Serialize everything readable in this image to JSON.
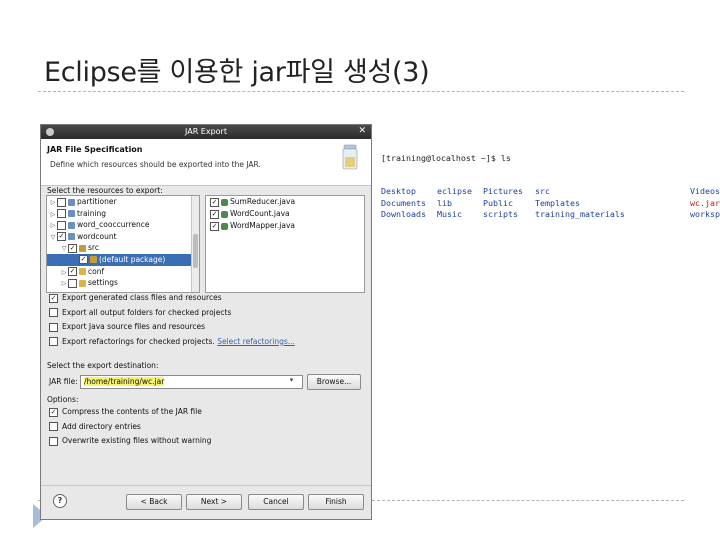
{
  "slide": {
    "title": "Eclipse를 이용한 jar파일 생성(3)"
  },
  "dialog": {
    "window_title": "JAR Export",
    "header_title": "JAR File Specification",
    "header_desc": "Define which resources should be exported into the JAR.",
    "resources_label": "Select the resources to export:",
    "tree": [
      {
        "indent": 0,
        "twisty": "▷",
        "checked": false,
        "icon": "project",
        "label": "partitioner",
        "selected": false
      },
      {
        "indent": 0,
        "twisty": "▷",
        "checked": false,
        "icon": "project",
        "label": "training",
        "selected": false
      },
      {
        "indent": 0,
        "twisty": "▷",
        "checked": false,
        "icon": "project",
        "label": "word_cooccurrence",
        "selected": false
      },
      {
        "indent": 0,
        "twisty": "▽",
        "checked": true,
        "icon": "project",
        "label": "wordcount",
        "selected": false
      },
      {
        "indent": 1,
        "twisty": "▽",
        "checked": true,
        "icon": "package",
        "label": "src",
        "selected": false
      },
      {
        "indent": 2,
        "twisty": "",
        "checked": true,
        "icon": "package",
        "label": "(default package)",
        "selected": true
      },
      {
        "indent": 1,
        "twisty": "▷",
        "checked": true,
        "icon": "folder",
        "label": "conf",
        "selected": false
      },
      {
        "indent": 1,
        "twisty": "▷",
        "checked": false,
        "icon": "folder",
        "label": "settings",
        "selected": false
      }
    ],
    "files": [
      {
        "checked": true,
        "label": "SumReducer.java"
      },
      {
        "checked": true,
        "label": "WordCount.java"
      },
      {
        "checked": true,
        "label": "WordMapper.java"
      }
    ],
    "export_options": [
      {
        "checked": true,
        "label": "Export generated class files and resources",
        "link": ""
      },
      {
        "checked": false,
        "label": "Export all output folders for checked projects",
        "link": ""
      },
      {
        "checked": false,
        "label": "Export Java source files and resources",
        "link": ""
      },
      {
        "checked": false,
        "label": "Export refactorings for checked projects.",
        "link": "Select refactorings..."
      }
    ],
    "destination_label": "Select the export destination:",
    "jar_file_label": "JAR file:",
    "jar_file_value": "/home/training/wc.jar",
    "browse_label": "Browse...",
    "options_label": "Options:",
    "options": [
      {
        "checked": true,
        "label": "Compress the contents of the JAR file"
      },
      {
        "checked": false,
        "label": "Add directory entries"
      },
      {
        "checked": false,
        "label": "Overwrite existing files without warning"
      }
    ],
    "buttons": {
      "back": "< Back",
      "next": "Next >",
      "cancel": "Cancel",
      "finish": "Finish"
    },
    "help_glyph": "?"
  },
  "terminal": {
    "prompt": "[training@localhost ~]$ ls",
    "rows": [
      [
        "Desktop",
        "eclipse",
        "Pictures",
        "src",
        "",
        "Videos"
      ],
      [
        "Documents",
        "lib",
        "Public",
        "Templates",
        "",
        "wc.jar"
      ],
      [
        "Downloads",
        "Music",
        "scripts",
        "training_materials",
        "",
        "workspace"
      ]
    ],
    "highlight": "wc.jar",
    "colors": {
      "text": "#1b3f9a",
      "highlight": "#c01818"
    }
  }
}
